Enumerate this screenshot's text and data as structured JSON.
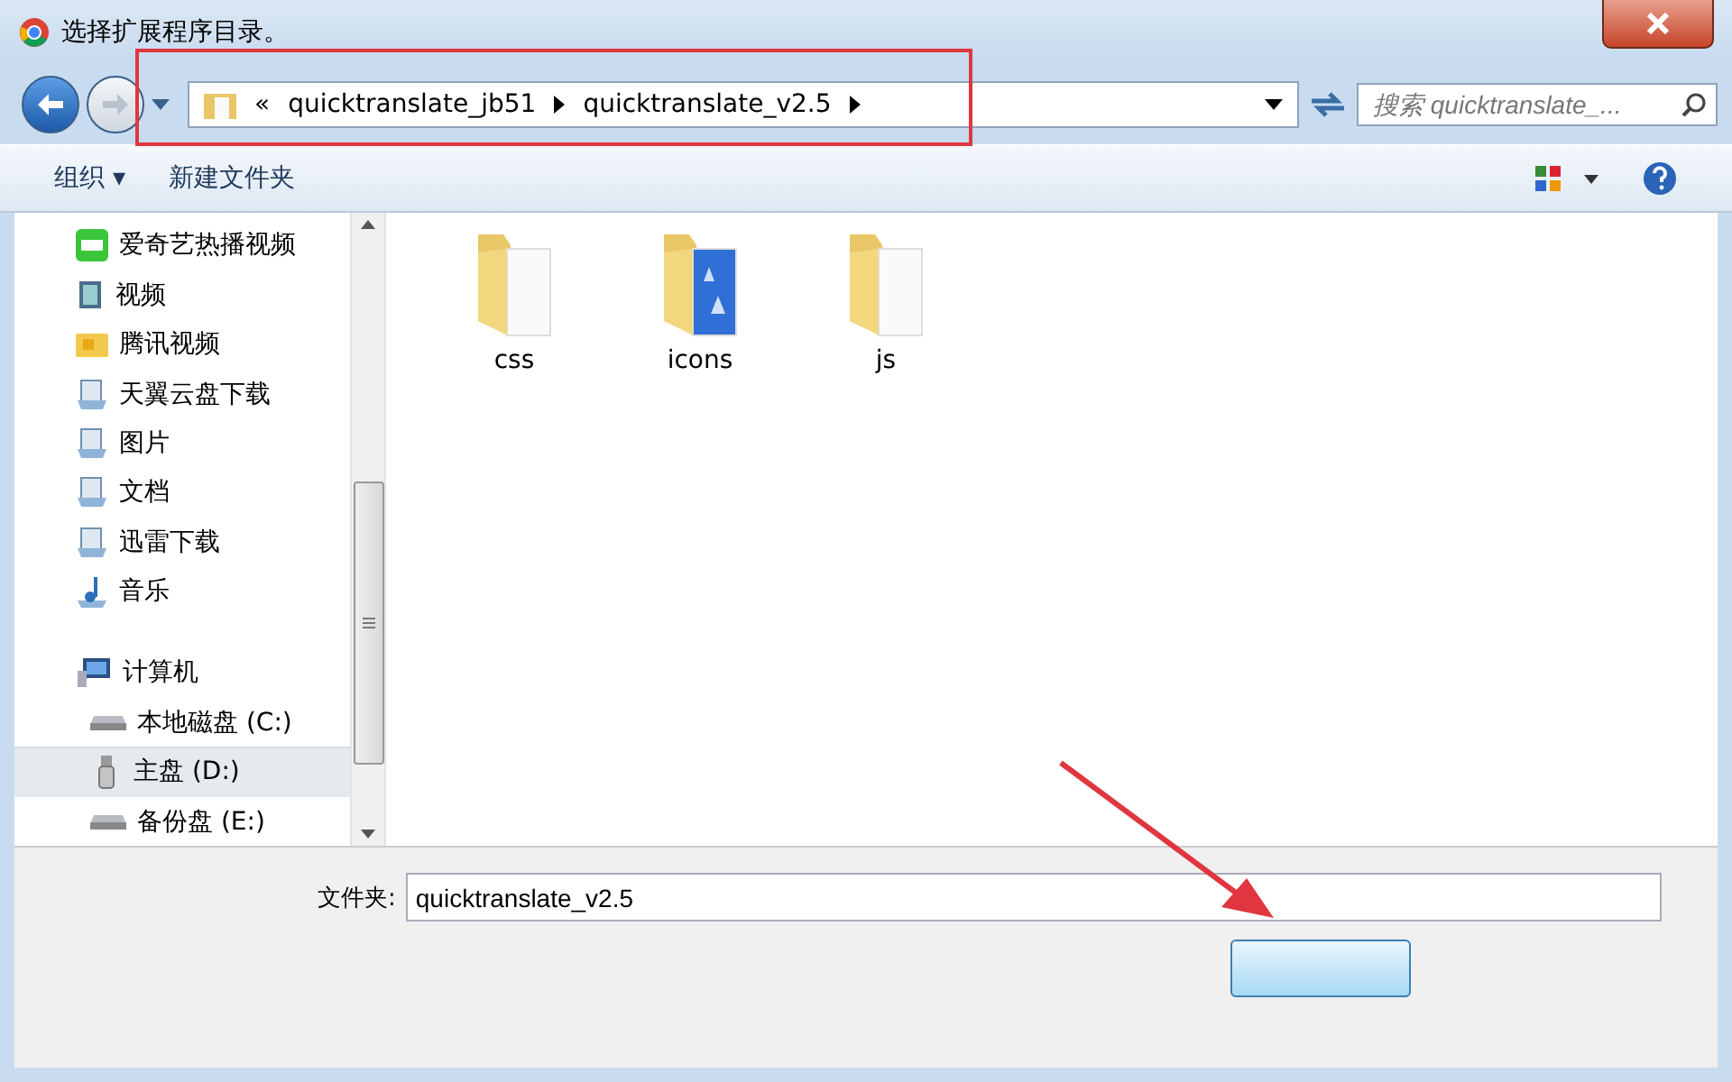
{
  "window": {
    "title": "选择扩展程序目录。"
  },
  "address": {
    "prefix": "«",
    "segments": [
      "quicktranslate_jb51",
      "quicktranslate_v2.5"
    ]
  },
  "search": {
    "placeholder": "搜索 quicktranslate_..."
  },
  "toolbar": {
    "organize": "组织 ▾",
    "new_folder": "新建文件夹"
  },
  "sidebar": {
    "items": [
      {
        "label": "爱奇艺热播视频",
        "kind": "app",
        "selected": false
      },
      {
        "label": "视频",
        "kind": "video",
        "selected": false
      },
      {
        "label": "腾讯视频",
        "kind": "folder",
        "selected": false
      },
      {
        "label": "天翼云盘下载",
        "kind": "library",
        "selected": false
      },
      {
        "label": "图片",
        "kind": "library",
        "selected": false
      },
      {
        "label": "文档",
        "kind": "library",
        "selected": false
      },
      {
        "label": "迅雷下载",
        "kind": "library",
        "selected": false
      },
      {
        "label": "音乐",
        "kind": "music",
        "selected": false
      },
      {
        "label": "计算机",
        "kind": "computer",
        "selected": false,
        "children": [
          {
            "label": "本地磁盘 (C:)",
            "kind": "disk",
            "selected": false
          },
          {
            "label": "主盘 (D:)",
            "kind": "usb",
            "selected": true
          },
          {
            "label": "备份盘 (E:)",
            "kind": "disk",
            "selected": false
          }
        ]
      }
    ]
  },
  "files": [
    {
      "name": "css",
      "kind": "folder"
    },
    {
      "name": "icons",
      "kind": "translate"
    },
    {
      "name": "js",
      "kind": "folder"
    }
  ],
  "folder_field": {
    "label": "文件夹:",
    "value": "quicktranslate_v2.5"
  }
}
